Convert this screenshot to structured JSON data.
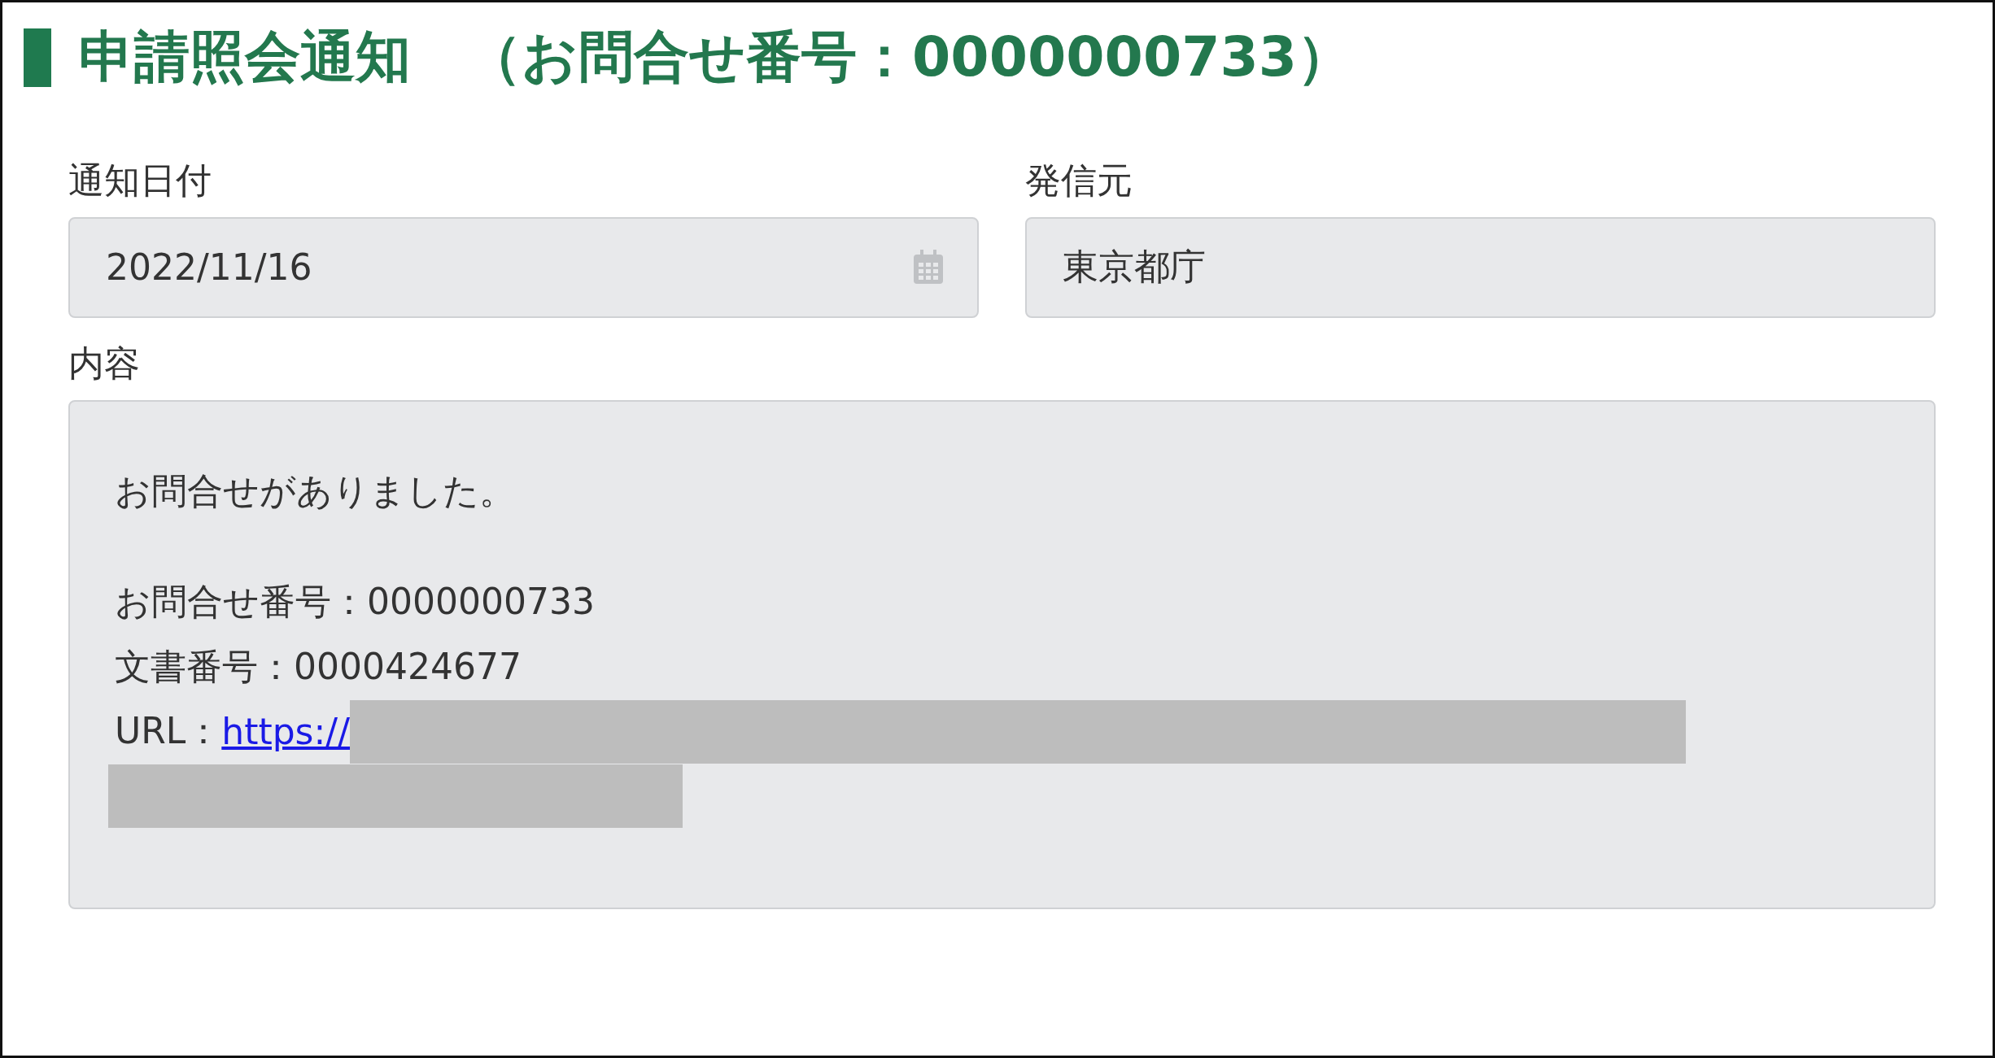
{
  "title": "申請照会通知　（お問合せ番号：0000000733）",
  "fields": [
    {
      "label": "通知日付",
      "value": "2022/11/16",
      "kind": "date"
    },
    {
      "label": "発信元",
      "value": "東京都庁",
      "kind": "text"
    }
  ],
  "content": {
    "label": "内容",
    "paragraphs": [
      [
        "お問合せがありました。"
      ],
      [
        "お問合せ番号：0000000733",
        "文書番号：0000424677"
      ]
    ],
    "url_label": "URL：",
    "url_link": "https://"
  }
}
